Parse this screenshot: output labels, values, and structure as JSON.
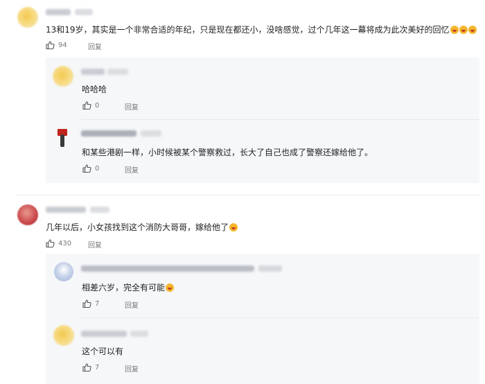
{
  "comments": [
    {
      "text": "13和19岁，其实是一个非常合适的年纪，只是现在都还小，没啥感觉，过个几年这一幕将成为此次美好的回忆",
      "emoji_count": 3,
      "likes": "94",
      "reply_label": "回复",
      "replies": [
        {
          "text": "哈哈哈",
          "likes": "0",
          "reply_label": "回复"
        },
        {
          "text": "和某些港剧一样，小时候被某个警察救过，长大了自己也成了警察还嫁给他了。",
          "likes": "0",
          "reply_label": "回复"
        }
      ]
    },
    {
      "text": "几年以后，小女孩找到这个消防大哥哥，嫁给他了",
      "emoji_count": 1,
      "likes": "430",
      "reply_label": "回复",
      "replies": [
        {
          "text": "相差六岁，完全有可能",
          "likes": "7",
          "reply_label": "回复"
        },
        {
          "text": "这个可以有",
          "likes": "7",
          "reply_label": "回复"
        }
      ]
    }
  ],
  "colors": {
    "reply_background": "#f6f7f9",
    "meta_text": "#777777",
    "emoji": "#f3b62b"
  },
  "icons": {
    "like": "thumbs-up-icon"
  }
}
